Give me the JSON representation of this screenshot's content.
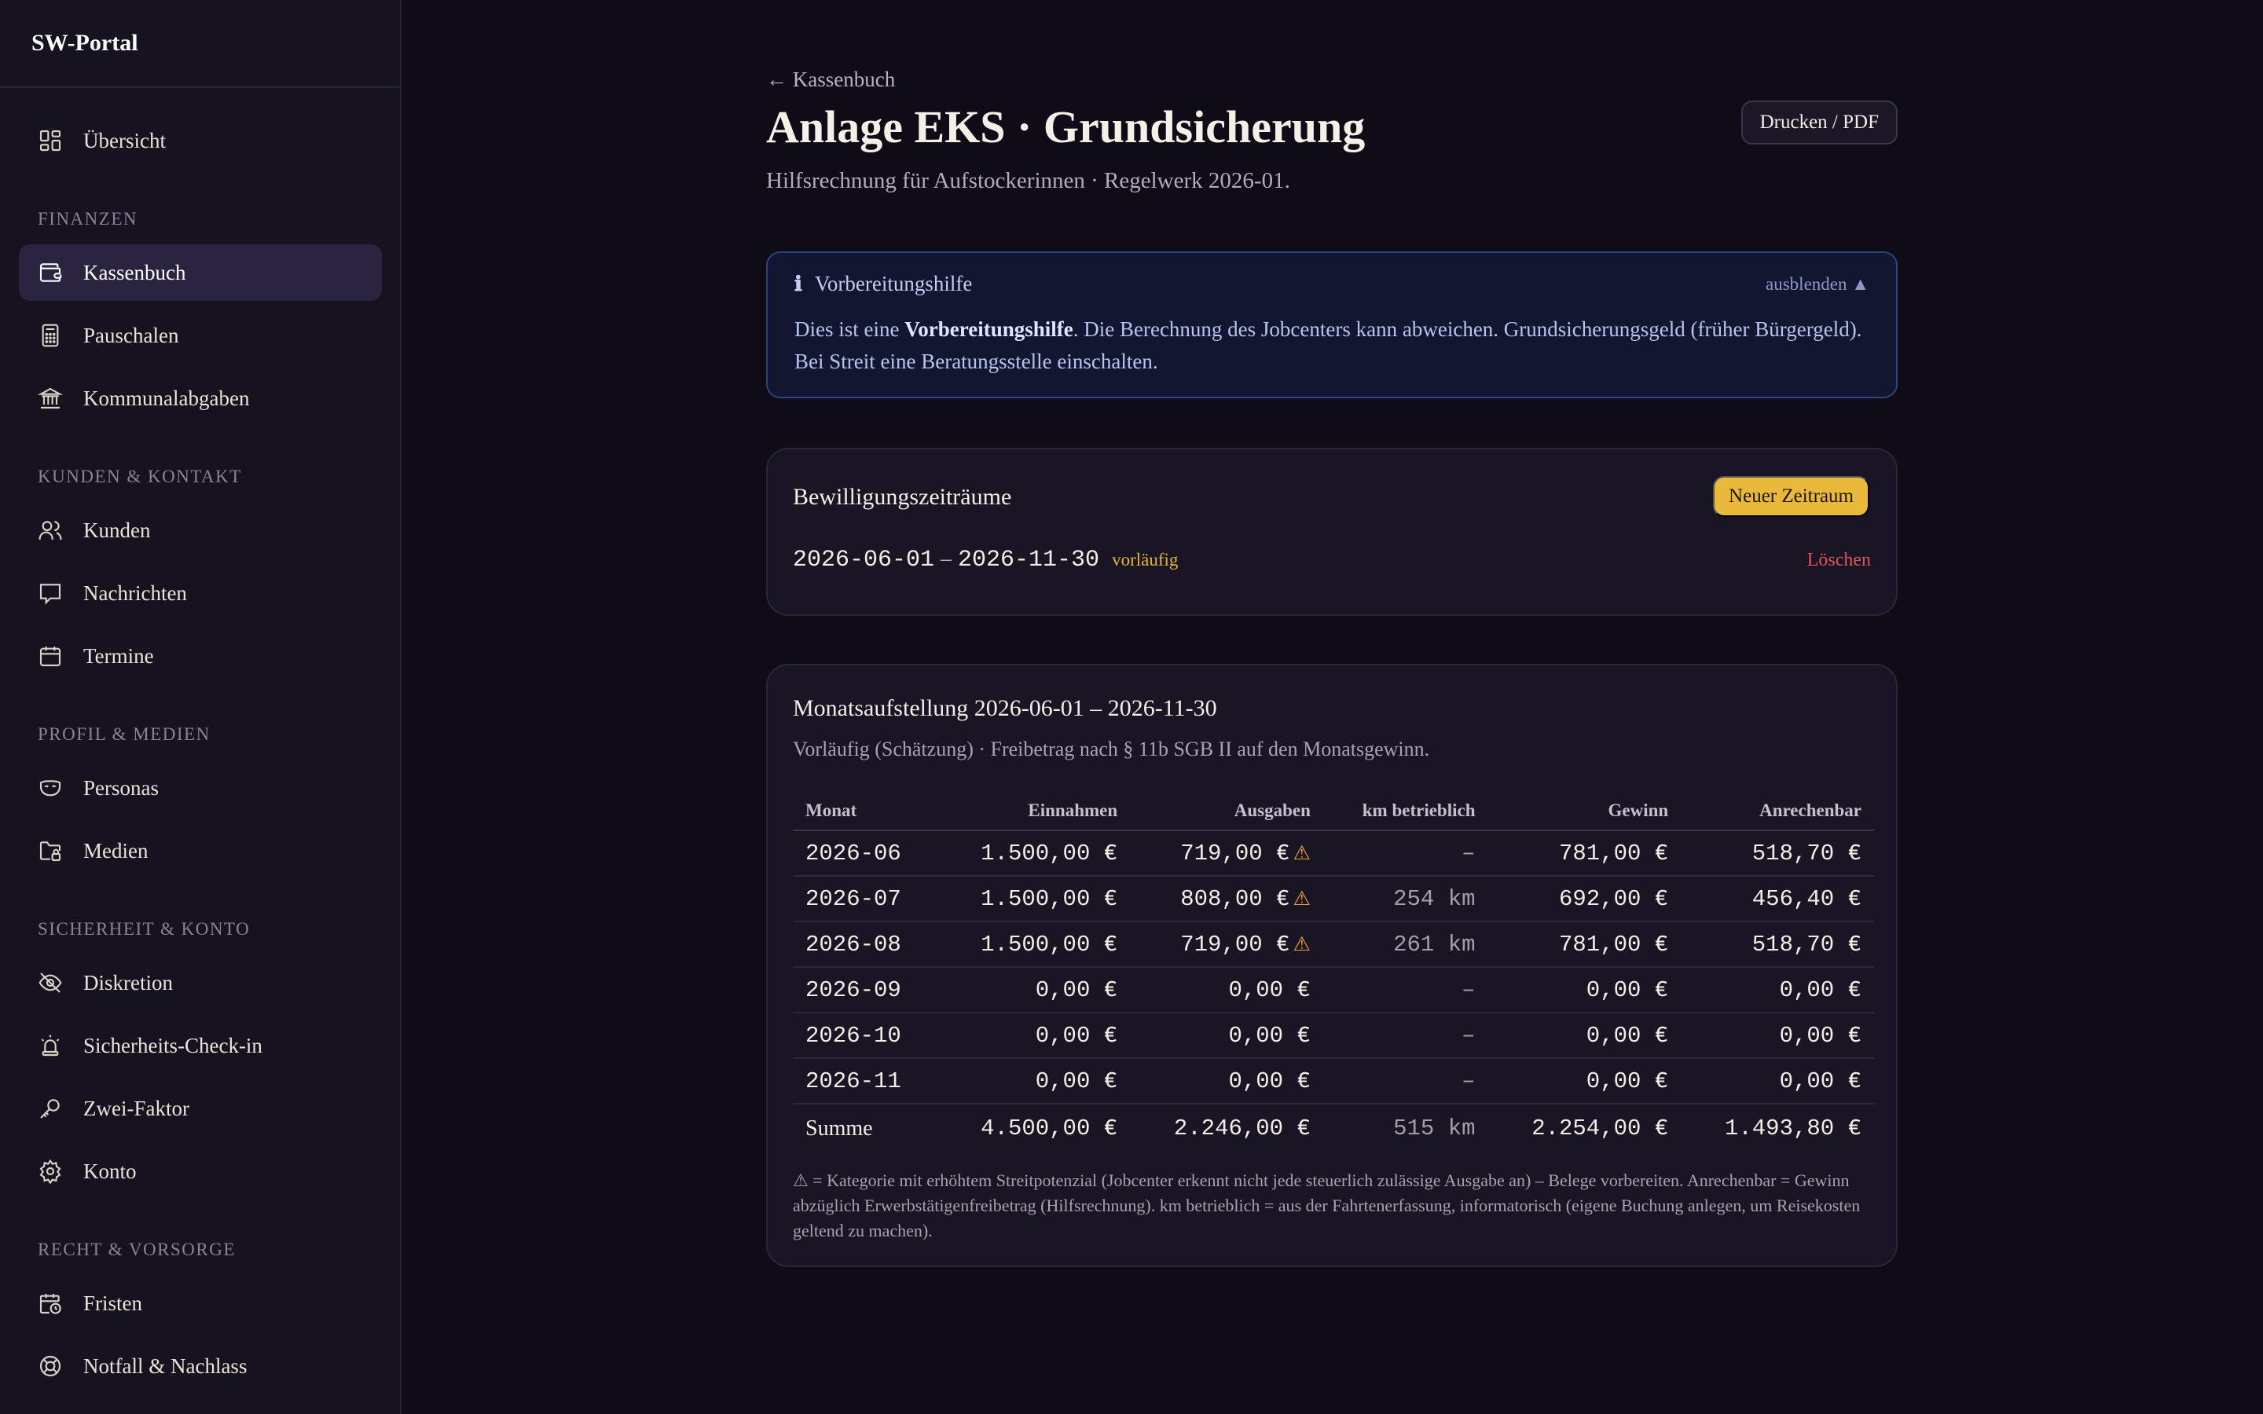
{
  "sidebar": {
    "brand": "SW-Portal",
    "overview": "Übersicht",
    "sections": {
      "finanzen": "FINANZEN",
      "kunden": "KUNDEN & KONTAKT",
      "profil": "PROFIL & MEDIEN",
      "sicherheit": "SICHERHEIT & KONTO",
      "recht": "RECHT & VORSORGE"
    },
    "items": {
      "kassenbuch": "Kassenbuch",
      "pauschalen": "Pauschalen",
      "kommunal": "Kommunalabgaben",
      "kunden": "Kunden",
      "nachrichten": "Nachrichten",
      "termine": "Termine",
      "personas": "Personas",
      "medien": "Medien",
      "diskretion": "Diskretion",
      "checkin": "Sicherheits-Check-in",
      "zweifaktor": "Zwei-Faktor",
      "konto": "Konto",
      "fristen": "Fristen",
      "notfall": "Notfall & Nachlass"
    },
    "active_item": "Kassenbuch"
  },
  "header": {
    "back": "← Kassenbuch",
    "title": "Anlage EKS · Grundsicherung",
    "subtitle": "Hilfsrechnung für Aufstockerinnen · Regelwerk 2026-01.",
    "print_button": "Drucken / PDF"
  },
  "info": {
    "title": "Vorbereitungshilfe",
    "hide": "ausblenden ▲",
    "text_pre": "Dies ist eine ",
    "text_bold": "Vorbereitungshilfe",
    "text_post": ". Die Berechnung des Jobcenters kann abweichen. Grundsicherungsgeld (früher Bürgergeld). Bei Streit eine Beratungsstelle einschalten."
  },
  "periods": {
    "title": "Bewilligungszeiträume",
    "new_button": "Neuer Zeitraum",
    "items": [
      {
        "start": "2026-06-01",
        "sep": "–",
        "end": "2026-11-30",
        "status": "vorläufig",
        "delete": "Löschen"
      }
    ]
  },
  "monthly": {
    "title": "Monatsaufstellung 2026-06-01 – 2026-11-30",
    "subtitle": "Vorläufig (Schätzung) · Freibetrag nach § 11b SGB II auf den Monatsgewinn.",
    "headers": [
      "Monat",
      "Einnahmen",
      "Ausgaben",
      "km betrieblich",
      "Gewinn",
      "Anrechenbar"
    ],
    "rows": [
      {
        "month": "2026-06",
        "income": "1.500,00 €",
        "expenses": "719,00 €",
        "warn": true,
        "km": "–",
        "profit": "781,00 €",
        "countable": "518,70 €"
      },
      {
        "month": "2026-07",
        "income": "1.500,00 €",
        "expenses": "808,00 €",
        "warn": true,
        "km": "254 km",
        "profit": "692,00 €",
        "countable": "456,40 €"
      },
      {
        "month": "2026-08",
        "income": "1.500,00 €",
        "expenses": "719,00 €",
        "warn": true,
        "km": "261 km",
        "profit": "781,00 €",
        "countable": "518,70 €"
      },
      {
        "month": "2026-09",
        "income": "0,00 €",
        "expenses": "0,00 €",
        "warn": false,
        "km": "–",
        "profit": "0,00 €",
        "countable": "0,00 €"
      },
      {
        "month": "2026-10",
        "income": "0,00 €",
        "expenses": "0,00 €",
        "warn": false,
        "km": "–",
        "profit": "0,00 €",
        "countable": "0,00 €"
      },
      {
        "month": "2026-11",
        "income": "0,00 €",
        "expenses": "0,00 €",
        "warn": false,
        "km": "–",
        "profit": "0,00 €",
        "countable": "0,00 €"
      }
    ],
    "sum": {
      "label": "Summe",
      "income": "4.500,00 €",
      "expenses": "2.246,00 €",
      "km": "515 km",
      "profit": "2.254,00 €",
      "countable": "1.493,80 €"
    },
    "warn_glyph": "⚠",
    "footnote": "⚠ = Kategorie mit erhöhtem Streitpotenzial (Jobcenter erkennt nicht jede steuerlich zulässige Ausgabe an) – Belege vorbereiten. Anrechenbar = Gewinn abzüglich Erwerbstätigenfreibetrag (Hilfsrechnung). km betrieblich = aus der Fahrtenerfassung, informatorisch (eigene Buchung anlegen, um Reisekosten geltend zu machen)."
  },
  "colors": {
    "background": "#0f0c17",
    "sidebar": "#16121f",
    "accent_yellow": "#e8b93a",
    "danger": "#e0535a",
    "warning": "#f0a238",
    "info_border": "#2a4580"
  }
}
